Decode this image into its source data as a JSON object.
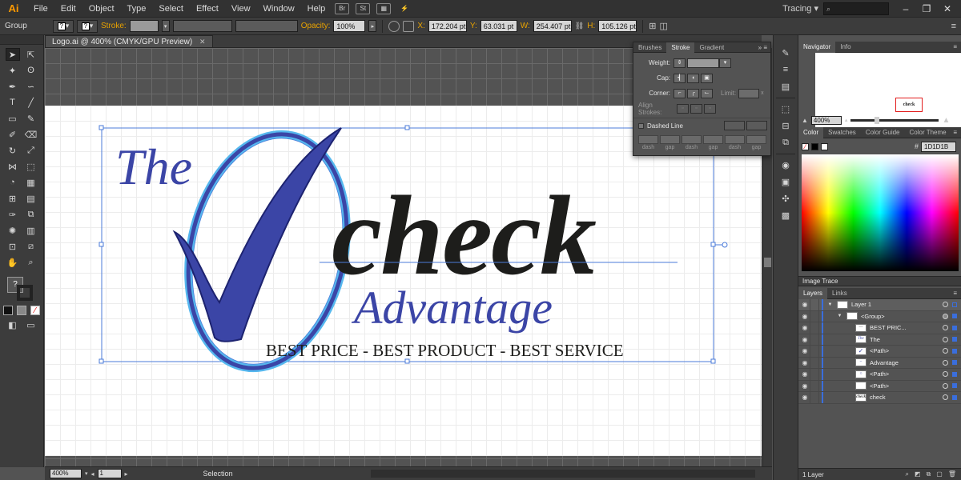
{
  "app": {
    "logo": "Ai"
  },
  "menu": {
    "items": [
      "File",
      "Edit",
      "Object",
      "Type",
      "Select",
      "Effect",
      "View",
      "Window",
      "Help"
    ],
    "icon_labels": [
      "Br",
      "St"
    ],
    "workspace": "Tracing",
    "search_placeholder": ""
  },
  "controlbar": {
    "selection_type": "Group",
    "stroke_label": "Stroke:",
    "opacity_label": "Opacity:",
    "opacity_value": "100%",
    "x_label": "X:",
    "x_value": "172.204 pt",
    "y_label": "Y:",
    "y_value": "63.031 pt",
    "w_label": "W:",
    "w_value": "254.407 pt",
    "h_label": "H:",
    "h_value": "105.126 pt"
  },
  "document": {
    "tab_title": "Logo.ai @ 400% (CMYK/GPU Preview)",
    "close": "✕"
  },
  "artwork": {
    "the": "The",
    "check": "check",
    "advantage": "Advantage",
    "tagline": "BEST PRICE - BEST PRODUCT - BEST SERVICE",
    "colors": {
      "blue": "#3b45a6",
      "light_blue": "#55b7ee",
      "black": "#1d1d1b",
      "selection": "#4b7bd9"
    }
  },
  "stroke_panel": {
    "tabs": [
      "Brushes",
      "Stroke",
      "Gradient"
    ],
    "active_tab": "Stroke",
    "weight_label": "Weight:",
    "cap_label": "Cap:",
    "corner_label": "Corner:",
    "limit_label": "Limit:",
    "align_label": "Align Strokes:",
    "dashed_label": "Dashed Line",
    "dash_labels": [
      "dash",
      "gap",
      "dash",
      "gap",
      "dash",
      "gap"
    ]
  },
  "navigator": {
    "tabs": [
      "Navigator",
      "Info"
    ],
    "zoom": "400%",
    "thumb_text": "check"
  },
  "color_panel": {
    "tabs": [
      "Color",
      "Swatches",
      "Color Guide",
      "Color Theme"
    ],
    "hex_label": "#",
    "hex_value": "1D1D1B"
  },
  "image_trace": {
    "label": "Image Trace"
  },
  "layers": {
    "tabs": [
      "Layers",
      "Links"
    ],
    "rows": [
      {
        "name": "Layer 1",
        "thumb": ""
      },
      {
        "name": "<Group>",
        "thumb": ""
      },
      {
        "name": "BEST PRIC...",
        "thumb": "—"
      },
      {
        "name": "The",
        "thumb": "The"
      },
      {
        "name": "<Path>",
        "thumb": "✓"
      },
      {
        "name": "Advantage",
        "thumb": "~"
      },
      {
        "name": "<Path>",
        "thumb": "○"
      },
      {
        "name": "<Path>",
        "thumb": ""
      },
      {
        "name": "check",
        "thumb": "check"
      }
    ],
    "footer": "1 Layer"
  },
  "statusbar": {
    "zoom": "400%",
    "artboard": "1",
    "tool": "Selection"
  }
}
